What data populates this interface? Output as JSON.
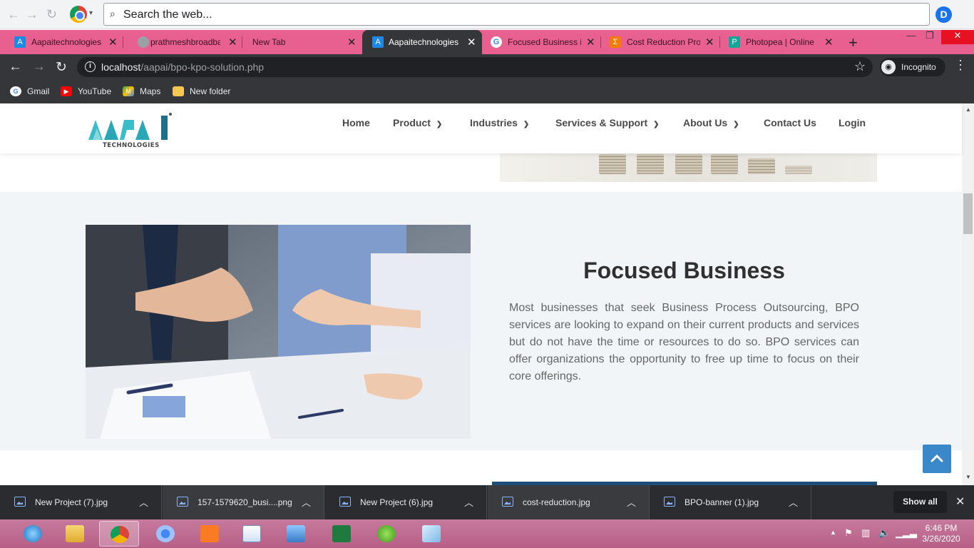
{
  "outer_bar": {
    "search_placeholder": "Search the web...",
    "profile_initial": "D"
  },
  "tabs": [
    {
      "title": "Aapaitechnologies",
      "favicon": "A",
      "color": "#1e88e5"
    },
    {
      "title": "prathmeshbroadba",
      "favicon": "",
      "color": "#9aa0a6"
    },
    {
      "title": "New Tab",
      "favicon": "",
      "color": ""
    },
    {
      "title": "Aapaitechnologies",
      "favicon": "A",
      "color": "#1e88e5",
      "active": true
    },
    {
      "title": "Focused Business i",
      "favicon": "G",
      "color": "#ffffff"
    },
    {
      "title": "Cost Reduction Pro",
      "favicon": "Σ",
      "color": "#f57c00"
    },
    {
      "title": "Photopea | Online",
      "favicon": "P",
      "color": "#18a497"
    }
  ],
  "toolbar": {
    "url_host": "localhost",
    "url_path": "/aapai/bpo-kpo-solution.php",
    "incognito_label": "Incognito"
  },
  "bookmarks": [
    {
      "label": "Gmail",
      "icon": "G",
      "color": "#ffffff"
    },
    {
      "label": "YouTube",
      "icon": "▶",
      "color": "#ff0000"
    },
    {
      "label": "Maps",
      "icon": "M",
      "color": "#34a853"
    },
    {
      "label": "New folder",
      "icon": "",
      "color": "#f9c74f"
    }
  ],
  "site": {
    "logo_text": "AAPAI",
    "logo_sub": "TECHNOLOGIES",
    "nav": [
      {
        "label": "Home",
        "dropdown": false
      },
      {
        "label": "Product",
        "dropdown": true
      },
      {
        "label": "Industries",
        "dropdown": true
      },
      {
        "label": "Services & Support",
        "dropdown": true
      },
      {
        "label": "About Us",
        "dropdown": true
      },
      {
        "label": "Contact Us",
        "dropdown": false
      },
      {
        "label": "Login",
        "dropdown": false
      }
    ],
    "section": {
      "title": "Focused Business",
      "body": "Most businesses that seek Business Process Outsourcing, BPO services are looking to expand on their current products and services but do not have the time or resources to do so. BPO services can offer organizations the opportunity to free up time to focus on their core offerings."
    }
  },
  "downloads": {
    "items": [
      {
        "filename": "New Project (7).jpg"
      },
      {
        "filename": "157-1579620_busi....png"
      },
      {
        "filename": "New Project (6).jpg"
      },
      {
        "filename": "cost-reduction.jpg"
      },
      {
        "filename": "BPO-banner (1).jpg"
      }
    ],
    "show_all": "Show all"
  },
  "taskbar": {
    "time": "6:46 PM",
    "date": "3/26/2020"
  },
  "colors": {
    "tab_strip": "#e8608f",
    "toolbar": "#35363a",
    "accent_blue": "#3a87c9",
    "section_bg": "#f1f5f8"
  }
}
